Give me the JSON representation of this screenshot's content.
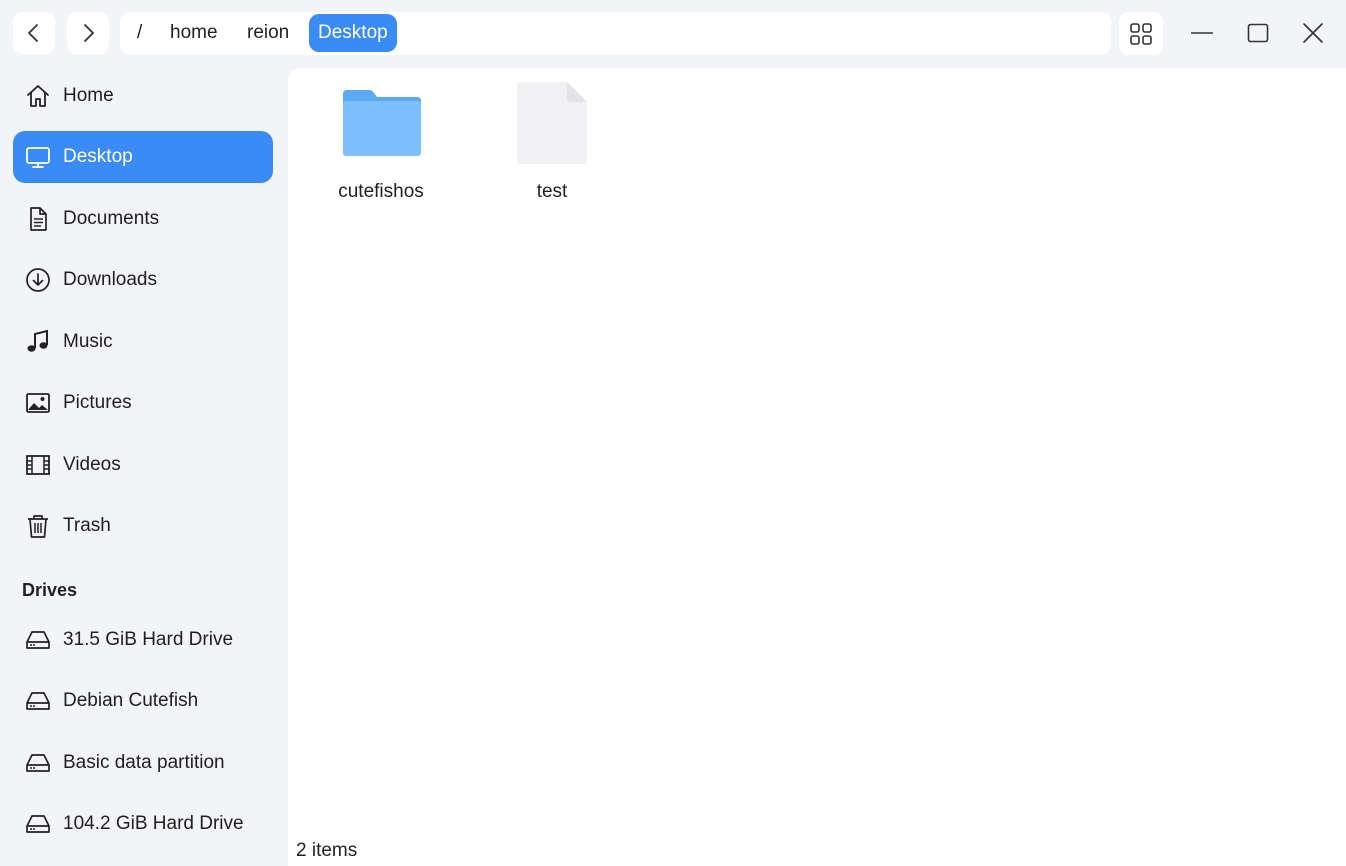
{
  "toolbar": {
    "back_icon": "chevron-left-icon",
    "forward_icon": "chevron-right-icon",
    "view_icon": "grid-view-icon"
  },
  "breadcrumb": {
    "root": "/",
    "items": [
      "home",
      "reion",
      "Desktop"
    ]
  },
  "window_controls": {
    "minimize_icon": "minimize-icon",
    "maximize_icon": "maximize-icon",
    "close_icon": "close-icon"
  },
  "sidebar": {
    "places": [
      {
        "label": "Home",
        "icon": "home-icon"
      },
      {
        "label": "Desktop",
        "icon": "monitor-icon",
        "selected": true
      },
      {
        "label": "Documents",
        "icon": "document-icon"
      },
      {
        "label": "Downloads",
        "icon": "download-icon"
      },
      {
        "label": "Music",
        "icon": "music-icon"
      },
      {
        "label": "Pictures",
        "icon": "picture-icon"
      },
      {
        "label": "Videos",
        "icon": "film-icon"
      },
      {
        "label": "Trash",
        "icon": "trash-icon"
      }
    ],
    "drives_title": "Drives",
    "drives": [
      {
        "label": "31.5 GiB Hard Drive",
        "icon": "hard-drive-icon"
      },
      {
        "label": "Debian Cutefish",
        "icon": "hard-drive-icon"
      },
      {
        "label": "Basic data partition",
        "icon": "hard-drive-icon"
      },
      {
        "label": "104.2 GiB Hard Drive",
        "icon": "hard-drive-icon"
      }
    ]
  },
  "files": [
    {
      "name": "cutefishos",
      "type": "folder",
      "icon": "folder-icon"
    },
    {
      "name": "test",
      "type": "file",
      "icon": "file-icon"
    }
  ],
  "status": {
    "text": "2 items"
  },
  "colors": {
    "accent": "#3a8bf5",
    "window_bg": "#f3f4f8",
    "content_bg": "#ffffff",
    "folder": "#6bb8ff"
  }
}
